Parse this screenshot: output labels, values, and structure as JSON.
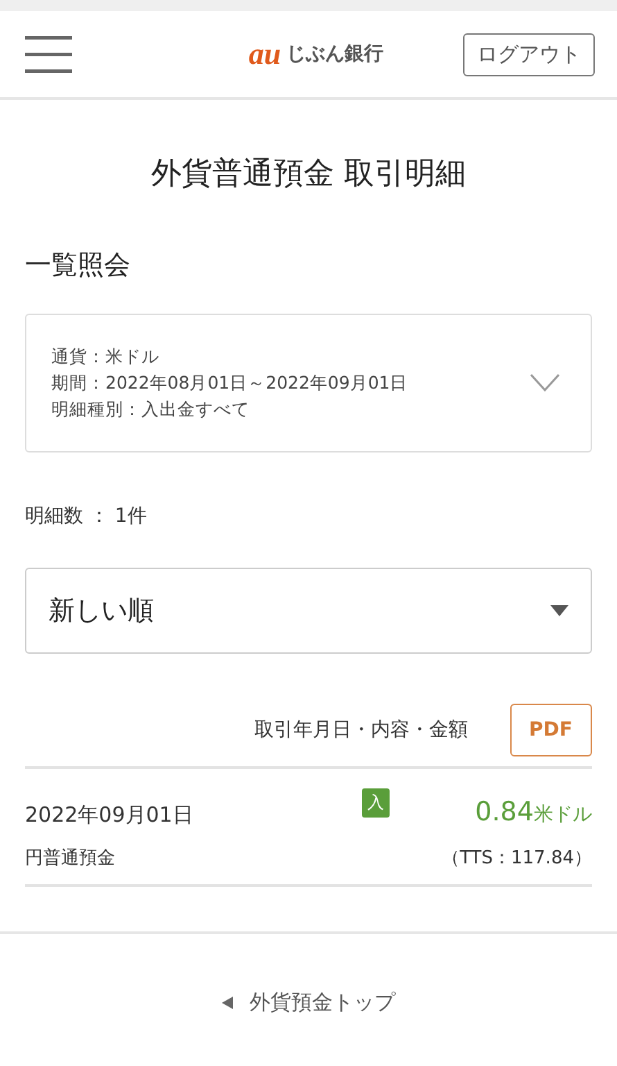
{
  "header": {
    "logo_mark": "au",
    "logo_text": "じぶん銀行",
    "logout_button": "ログアウト"
  },
  "title": "外貨普通預金 取引明細",
  "section_title": "一覧照会",
  "filter": {
    "lines": [
      "通貨：米ドル",
      "期間：2022年08月01日～2022年09月01日",
      "明細種別：入出金すべて"
    ],
    "expanded": false
  },
  "count": "明細数 ： 1件",
  "sort": {
    "value": "新しい順"
  },
  "table": {
    "column_header": "取引年月日・内容・金額",
    "pdf_button": "PDF",
    "rows": [
      {
        "date": "2022年09月01日",
        "badge": "入",
        "kind": "deposit",
        "amount": "0.84",
        "currency": "米ドル",
        "account": "円普通預金",
        "rate": "（TTS：117.84）"
      }
    ]
  },
  "footer_link": "外貨預金トップ"
}
